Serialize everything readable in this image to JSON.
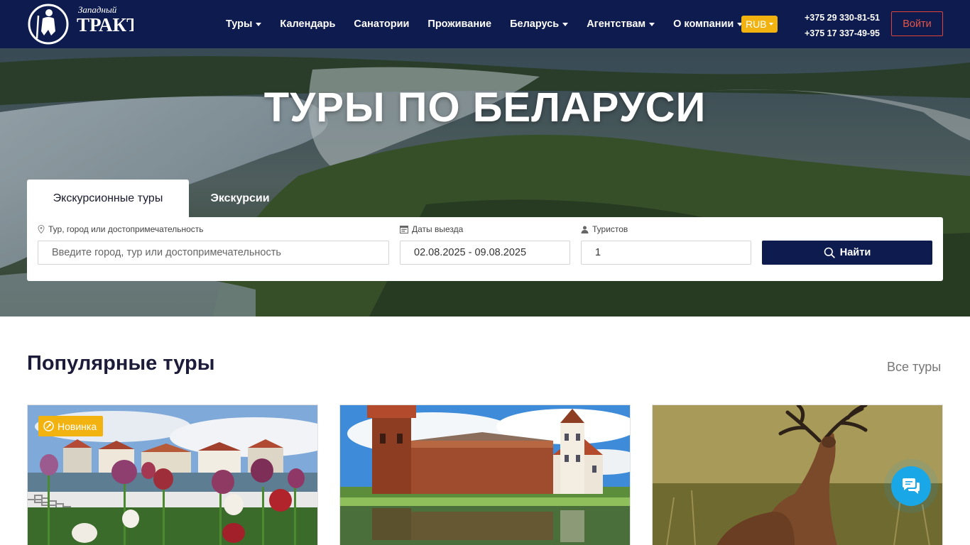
{
  "brand": {
    "logo_text_top": "Западный",
    "logo_text_main": "ТРАКТ",
    "logo_icon": "traveler-logo-icon"
  },
  "nav": {
    "items": [
      {
        "label": "Туры",
        "dropdown": true
      },
      {
        "label": "Календарь",
        "dropdown": false
      },
      {
        "label": "Санатории",
        "dropdown": false
      },
      {
        "label": "Проживание",
        "dropdown": false
      },
      {
        "label": "Беларусь",
        "dropdown": true
      },
      {
        "label": "Агентствам",
        "dropdown": true
      },
      {
        "label": "О компании",
        "dropdown": true
      }
    ],
    "currency": "RUB",
    "phones": [
      "+375 29 330-81-51",
      "+375 17 337-49-95"
    ],
    "login_label": "Войти"
  },
  "hero": {
    "title": "ТУРЫ ПО БЕЛАРУСИ",
    "tabs": [
      {
        "label": "Экскурсионные туры",
        "active": true
      },
      {
        "label": "Экскурсии",
        "active": false
      }
    ],
    "search": {
      "destination_label": "Тур, город или достопримечательность",
      "destination_placeholder": "Введите город, тур или достопримечательность",
      "dates_label": "Даты выезда",
      "dates_value": "02.08.2025 - 09.08.2025",
      "tourists_label": "Туристов",
      "tourists_value": "1",
      "submit_label": "Найти"
    }
  },
  "popular": {
    "title": "Популярные туры",
    "all_link": "Все туры",
    "cards": [
      {
        "badge": "Новинка",
        "image": "tulips-riverside-town"
      },
      {
        "badge": "",
        "image": "mir-castle"
      },
      {
        "badge": "",
        "image": "red-deer"
      }
    ]
  },
  "colors": {
    "header_bg": "#0d1b4f",
    "accent_yellow": "#f2b311",
    "login_red": "#e0433a",
    "chat_blue": "#1aa7e8"
  }
}
